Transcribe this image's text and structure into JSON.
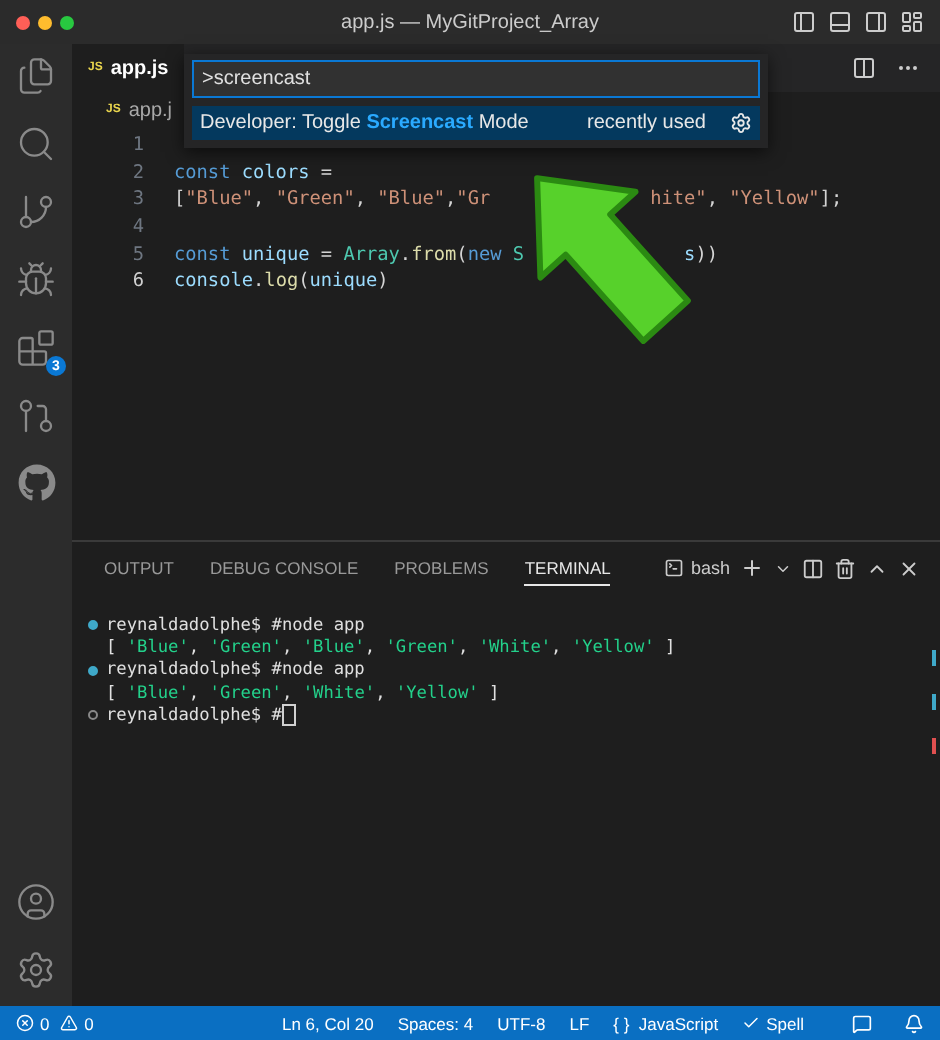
{
  "window": {
    "title": "app.js — MyGitProject_Array"
  },
  "activity_bar": {
    "top": [
      {
        "kind": "files"
      },
      {
        "kind": "search"
      },
      {
        "kind": "source-control"
      },
      {
        "kind": "run"
      },
      {
        "kind": "extensions",
        "badge": "3"
      },
      {
        "kind": "git"
      },
      {
        "kind": "github"
      }
    ],
    "bottom": [
      {
        "kind": "account"
      },
      {
        "kind": "settings"
      }
    ]
  },
  "editor": {
    "tab": {
      "icon_label": "JS",
      "label": "app.js"
    },
    "breadcrumb": {
      "icon_label": "JS",
      "label": "app.j"
    },
    "lines": [
      {
        "number": "1",
        "current": false
      },
      {
        "number": "2",
        "current": false,
        "segments": [
          {
            "kind": "keyword",
            "text": "const"
          },
          {
            "kind": "ident",
            "text": " colors"
          },
          {
            "kind": "punct",
            "text": " ="
          }
        ]
      },
      {
        "number": "3",
        "current": false,
        "segments": [
          {
            "kind": "punct",
            "text": "["
          },
          {
            "kind": "string",
            "text": "\"Blue\""
          },
          {
            "kind": "punct",
            "text": ", "
          },
          {
            "kind": "string",
            "text": "\"Green\""
          },
          {
            "kind": "punct",
            "text": ", "
          },
          {
            "kind": "string",
            "text": "\"Blue\""
          },
          {
            "kind": "punct",
            "text": ","
          },
          {
            "kind": "string",
            "text": "\"Gr"
          },
          {
            "kind": "covered"
          },
          {
            "kind": "string",
            "text": "hite\""
          },
          {
            "kind": "punct",
            "text": ", "
          },
          {
            "kind": "string",
            "text": "\"Yellow\""
          },
          {
            "kind": "punct",
            "text": "];"
          }
        ]
      },
      {
        "number": "4",
        "current": false
      },
      {
        "number": "5",
        "current": false,
        "segments": [
          {
            "kind": "keyword",
            "text": "const"
          },
          {
            "kind": "ident",
            "text": " unique"
          },
          {
            "kind": "punct",
            "text": " = "
          },
          {
            "kind": "class",
            "text": "Array"
          },
          {
            "kind": "punct",
            "text": "."
          },
          {
            "kind": "func",
            "text": "from"
          },
          {
            "kind": "punct",
            "text": "("
          },
          {
            "kind": "keyword",
            "text": "new"
          },
          {
            "kind": "class",
            "text": " S"
          },
          {
            "kind": "covered"
          },
          {
            "kind": "ident",
            "text": "s"
          },
          {
            "kind": "punct",
            "text": "))"
          }
        ]
      },
      {
        "number": "6",
        "current": true,
        "segments": [
          {
            "kind": "ident",
            "text": "console"
          },
          {
            "kind": "punct",
            "text": "."
          },
          {
            "kind": "func",
            "text": "log"
          },
          {
            "kind": "punct",
            "text": "("
          },
          {
            "kind": "ident",
            "text": "unique"
          },
          {
            "kind": "punct",
            "text": ")"
          }
        ]
      }
    ]
  },
  "command_palette": {
    "value": ">screencast",
    "result": {
      "label_parts": [
        {
          "text": "Developer: Toggle ",
          "match": false
        },
        {
          "text": "Screencast",
          "match": true
        },
        {
          "text": " Mode",
          "match": false
        }
      ],
      "hint": "recently used",
      "selected": true
    }
  },
  "panel": {
    "tabs": [
      {
        "label": "OUTPUT",
        "selected": false
      },
      {
        "label": "DEBUG CONSOLE",
        "selected": false
      },
      {
        "label": "PROBLEMS",
        "selected": false
      },
      {
        "label": "TERMINAL",
        "selected": true
      }
    ],
    "shell": "bash",
    "terminal": [
      {
        "kind": "prompt",
        "success": true,
        "text": "reynaldadolphe$ #node app"
      },
      {
        "kind": "output",
        "segments": [
          {
            "kind": "punct",
            "text": "[ "
          },
          {
            "kind": "string",
            "text": "'Blue'"
          },
          {
            "kind": "punct",
            "text": ", "
          },
          {
            "kind": "string",
            "text": "'Green'"
          },
          {
            "kind": "punct",
            "text": ", "
          },
          {
            "kind": "string",
            "text": "'Blue'"
          },
          {
            "kind": "punct",
            "text": ", "
          },
          {
            "kind": "string",
            "text": "'Green'"
          },
          {
            "kind": "punct",
            "text": ", "
          },
          {
            "kind": "string",
            "text": "'White'"
          },
          {
            "kind": "punct",
            "text": ", "
          },
          {
            "kind": "string",
            "text": "'Yellow'"
          },
          {
            "kind": "punct",
            "text": " ]"
          }
        ]
      },
      {
        "kind": "prompt",
        "success": true,
        "text": "reynaldadolphe$ #node app"
      },
      {
        "kind": "output",
        "segments": [
          {
            "kind": "punct",
            "text": "[ "
          },
          {
            "kind": "string",
            "text": "'Blue'"
          },
          {
            "kind": "punct",
            "text": ", "
          },
          {
            "kind": "string",
            "text": "'Green'"
          },
          {
            "kind": "punct",
            "text": ", "
          },
          {
            "kind": "string",
            "text": "'White'"
          },
          {
            "kind": "punct",
            "text": ", "
          },
          {
            "kind": "string",
            "text": "'Yellow'"
          },
          {
            "kind": "punct",
            "text": " ]"
          }
        ]
      },
      {
        "kind": "prompt",
        "success": false,
        "text": "reynaldadolphe$ #",
        "cursor": true
      }
    ]
  },
  "status_bar": {
    "errors": "0",
    "warnings": "0",
    "items": [
      "Ln 6, Col 20",
      "Spaces: 4",
      "UTF-8",
      "LF"
    ],
    "language_icon": "{ }",
    "language": "JavaScript",
    "spell": "Spell"
  }
}
